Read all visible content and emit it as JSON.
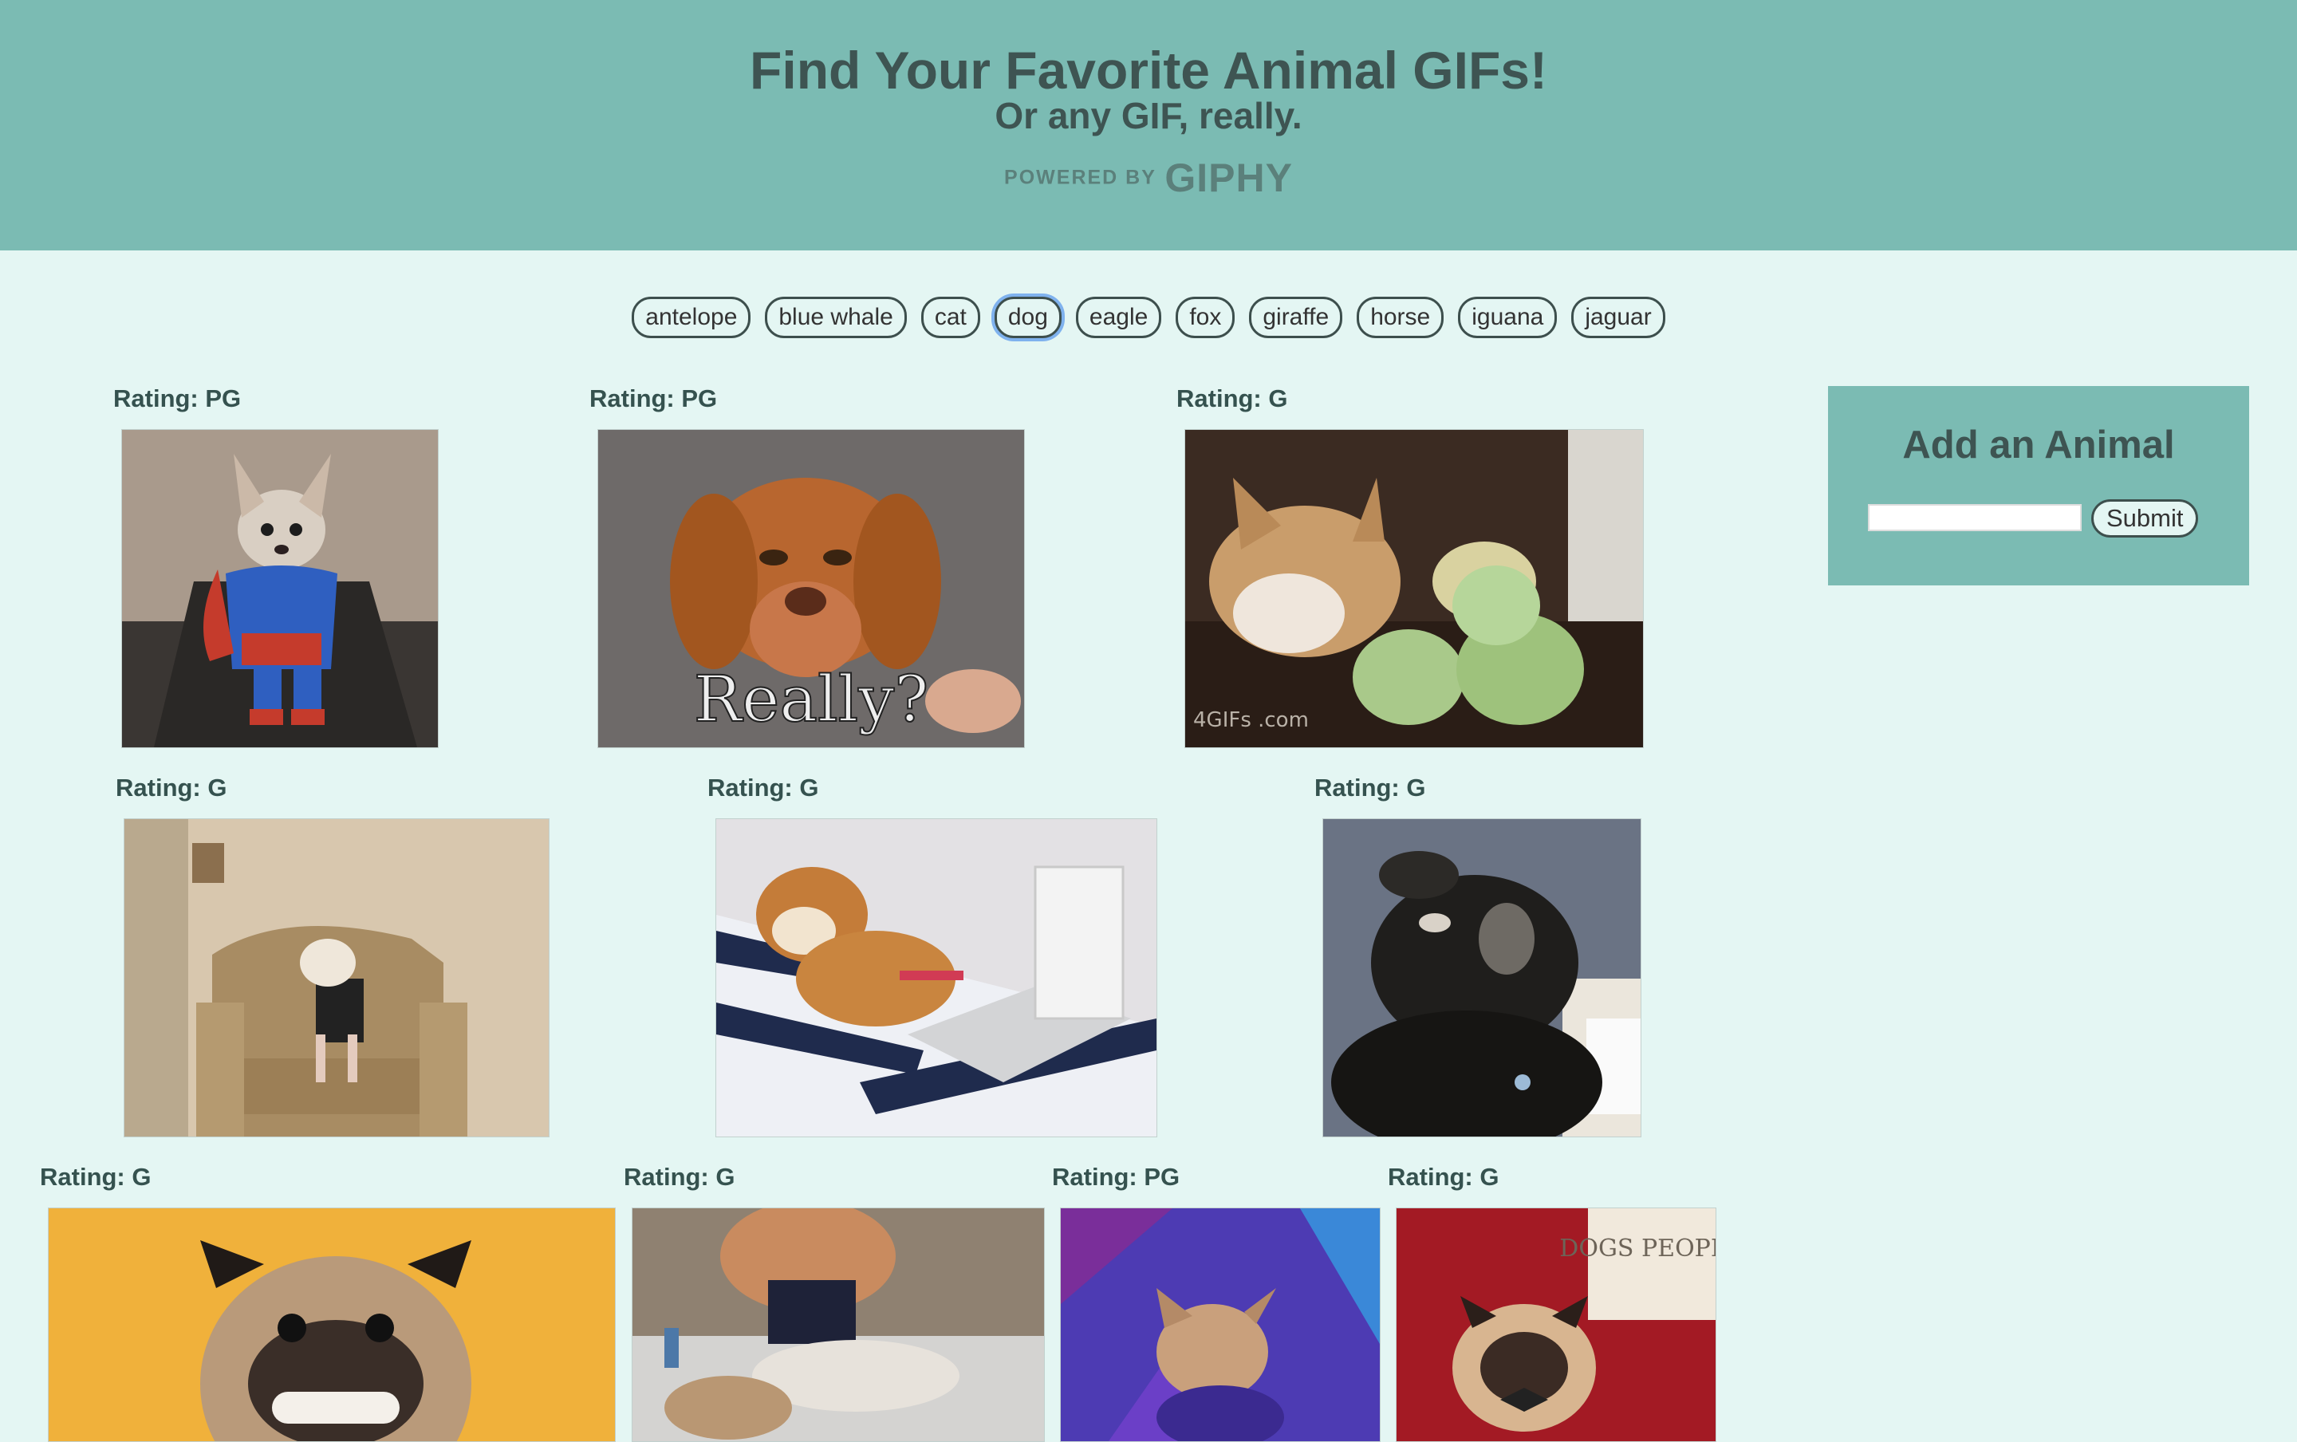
{
  "header": {
    "title": "Find Your Favorite Animal GIFs!",
    "subtitle": "Or any GIF, really.",
    "powered_by": "POWERED BY",
    "brand": "GIPHY"
  },
  "animals": [
    {
      "label": "antelope"
    },
    {
      "label": "blue whale"
    },
    {
      "label": "cat"
    },
    {
      "label": "dog"
    },
    {
      "label": "eagle"
    },
    {
      "label": "fox"
    },
    {
      "label": "giraffe"
    },
    {
      "label": "horse"
    },
    {
      "label": "iguana"
    },
    {
      "label": "jaguar"
    }
  ],
  "selected_animal": "dog",
  "gifs": [
    {
      "rating": "Rating: PG",
      "caption": "",
      "watermark": ""
    },
    {
      "rating": "Rating: PG",
      "caption": "Really?",
      "watermark": ""
    },
    {
      "rating": "Rating: G",
      "caption": "",
      "watermark": "4GIFs .com"
    },
    {
      "rating": "Rating: G",
      "caption": "",
      "watermark": ""
    },
    {
      "rating": "Rating: G",
      "caption": "",
      "watermark": ""
    },
    {
      "rating": "Rating: G",
      "caption": "",
      "watermark": ""
    },
    {
      "rating": "Rating: G",
      "caption": "",
      "watermark": ""
    },
    {
      "rating": "Rating: G",
      "caption": "",
      "watermark": ""
    },
    {
      "rating": "Rating: PG",
      "caption": "",
      "watermark": ""
    },
    {
      "rating": "Rating: G",
      "caption": "",
      "watermark": "DOGS PEOPLE"
    }
  ],
  "add_form": {
    "title": "Add an Animal",
    "input_value": "",
    "submit_label": "Submit"
  }
}
